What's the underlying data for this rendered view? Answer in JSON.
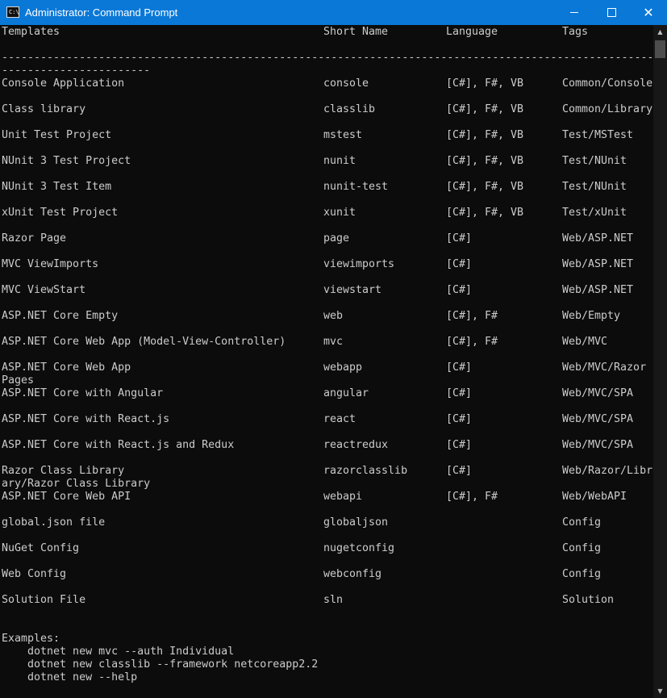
{
  "window": {
    "title": "Administrator: Command Prompt",
    "app_icon_text": "C:\\",
    "minimize_glyph": "minimize",
    "maximize_glyph": "maximize",
    "close_glyph": "✕"
  },
  "table": {
    "headers": [
      "Templates",
      "Short Name",
      "Language",
      "Tags"
    ],
    "separator_1": "--------------------------------------------------------------------------------------------------------",
    "separator_2": "-----------------------",
    "rows": [
      {
        "name": "Console Application",
        "short": "console",
        "lang": "[C#], F#, VB",
        "tags": "Common/Console"
      },
      {
        "name": "Class library",
        "short": "classlib",
        "lang": "[C#], F#, VB",
        "tags": "Common/Library"
      },
      {
        "name": "Unit Test Project",
        "short": "mstest",
        "lang": "[C#], F#, VB",
        "tags": "Test/MSTest"
      },
      {
        "name": "NUnit 3 Test Project",
        "short": "nunit",
        "lang": "[C#], F#, VB",
        "tags": "Test/NUnit"
      },
      {
        "name": "NUnit 3 Test Item",
        "short": "nunit-test",
        "lang": "[C#], F#, VB",
        "tags": "Test/NUnit"
      },
      {
        "name": "xUnit Test Project",
        "short": "xunit",
        "lang": "[C#], F#, VB",
        "tags": "Test/xUnit"
      },
      {
        "name": "Razor Page",
        "short": "page",
        "lang": "[C#]",
        "tags": "Web/ASP.NET"
      },
      {
        "name": "MVC ViewImports",
        "short": "viewimports",
        "lang": "[C#]",
        "tags": "Web/ASP.NET"
      },
      {
        "name": "MVC ViewStart",
        "short": "viewstart",
        "lang": "[C#]",
        "tags": "Web/ASP.NET"
      },
      {
        "name": "ASP.NET Core Empty",
        "short": "web",
        "lang": "[C#], F#",
        "tags": "Web/Empty"
      },
      {
        "name": "ASP.NET Core Web App (Model-View-Controller)",
        "short": "mvc",
        "lang": "[C#], F#",
        "tags": "Web/MVC"
      },
      {
        "name": "ASP.NET Core Web App",
        "short": "webapp",
        "lang": "[C#]",
        "tags": "Web/MVC/Razor",
        "wrap": "Pages"
      },
      {
        "name": "ASP.NET Core with Angular",
        "short": "angular",
        "lang": "[C#]",
        "tags": "Web/MVC/SPA"
      },
      {
        "name": "ASP.NET Core with React.js",
        "short": "react",
        "lang": "[C#]",
        "tags": "Web/MVC/SPA"
      },
      {
        "name": "ASP.NET Core with React.js and Redux",
        "short": "reactredux",
        "lang": "[C#]",
        "tags": "Web/MVC/SPA"
      },
      {
        "name": "Razor Class Library",
        "short": "razorclasslib",
        "lang": "[C#]",
        "tags": "Web/Razor/Libr",
        "wrap": "ary/Razor Class Library"
      },
      {
        "name": "ASP.NET Core Web API",
        "short": "webapi",
        "lang": "[C#], F#",
        "tags": "Web/WebAPI"
      },
      {
        "name": "global.json file",
        "short": "globaljson",
        "lang": "",
        "tags": "Config"
      },
      {
        "name": "NuGet Config",
        "short": "nugetconfig",
        "lang": "",
        "tags": "Config"
      },
      {
        "name": "Web Config",
        "short": "webconfig",
        "lang": "",
        "tags": "Config"
      },
      {
        "name": "Solution File",
        "short": "sln",
        "lang": "",
        "tags": "Solution"
      }
    ]
  },
  "examples": {
    "heading": "Examples:",
    "lines": [
      "    dotnet new mvc --auth Individual",
      "    dotnet new classlib --framework netcoreapp2.2",
      "    dotnet new --help"
    ]
  },
  "colors": {
    "titlebar": "#0a78d7",
    "console_bg": "#0c0c0c",
    "console_text": "#cccccc"
  }
}
